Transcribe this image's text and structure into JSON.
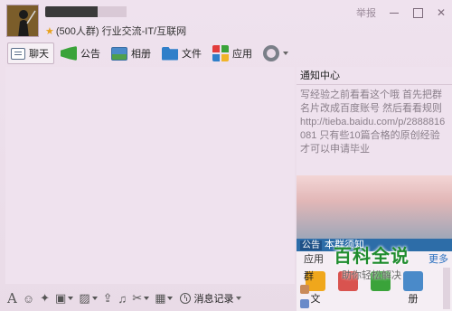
{
  "header": {
    "group_info": "(500人群) 行业交流-IT/互联网",
    "report_label": "举报"
  },
  "tabs": [
    {
      "label": "聊天",
      "icon": "chat-icon",
      "active": true
    },
    {
      "label": "公告",
      "icon": "announcement-icon",
      "active": false
    },
    {
      "label": "相册",
      "icon": "album-icon",
      "active": false
    },
    {
      "label": "文件",
      "icon": "file-icon",
      "active": false
    },
    {
      "label": "应用",
      "icon": "app-icon",
      "active": false
    }
  ],
  "input_toolbar": {
    "history_label": "消息记录"
  },
  "notice_center": {
    "title": "通知中心",
    "body": "写经验之前看看这个哦 首先把群名片改成百度账号 然后看看规则 http://tieba.baidu.com/p/2888816081 只有些10篇合格的原创经验才可以申请毕业"
  },
  "group_notice": {
    "badge": "公告",
    "title": "本群须知"
  },
  "apps": {
    "title": "应用",
    "more_label": "更多",
    "items": [
      {
        "label": "文",
        "color": "#f0a71c"
      },
      {
        "label": "",
        "color": "#d9534f"
      },
      {
        "label": "",
        "color": "#3aa33a"
      },
      {
        "label": "册",
        "color": "#4a8ac9"
      }
    ]
  },
  "members": {
    "label": "群"
  },
  "brand": {
    "title": "百科全说",
    "subtitle": "助你轻松解决"
  },
  "colors": {
    "background": "#e9dbe7",
    "notice_bar": "#2d6da8",
    "brand_green": "#1f8c2e",
    "link": "#2a6fbf"
  }
}
